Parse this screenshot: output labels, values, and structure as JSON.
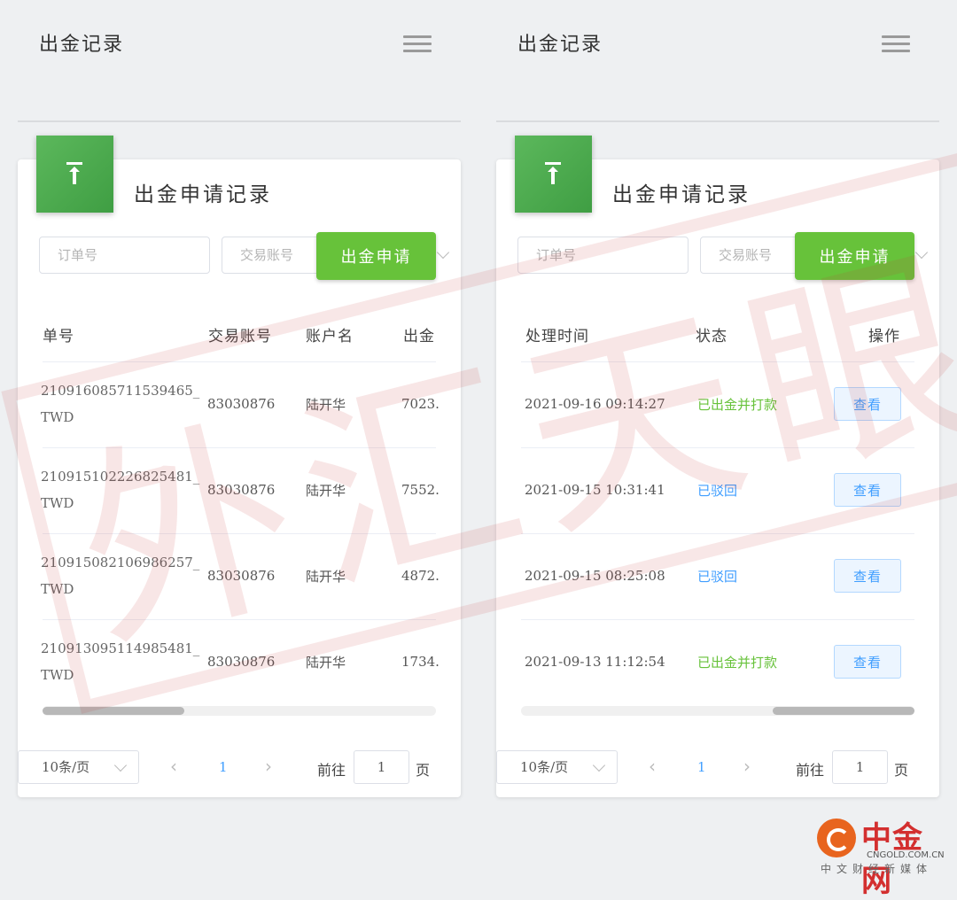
{
  "left": {
    "header": {
      "title": "出金记录"
    },
    "card": {
      "title": "出金申请记录",
      "filters": {
        "order_placeholder": "订单号",
        "account_placeholder": "交易账号",
        "apply_label": "出金申请"
      },
      "columns": [
        "单号",
        "交易账号",
        "账户名",
        "出金"
      ],
      "rows": [
        {
          "order": "210916085711539465_",
          "suffix": "TWD",
          "account": "83030876",
          "name": "陆开华",
          "amount": "7023."
        },
        {
          "order": "210915102226825481_",
          "suffix": "TWD",
          "account": "83030876",
          "name": "陆开华",
          "amount": "7552."
        },
        {
          "order": "210915082106986257_",
          "suffix": "TWD",
          "account": "83030876",
          "name": "陆开华",
          "amount": "4872."
        },
        {
          "order": "210913095114985481_",
          "suffix": "TWD",
          "account": "83030876",
          "name": "陆开华",
          "amount": "1734."
        }
      ],
      "scroll_position": 0.0
    },
    "pagination": {
      "page_size": "10条/页",
      "prev": "‹",
      "current": "1",
      "next": "›",
      "goto_label": "前往",
      "goto_value": "1",
      "goto_unit": "页"
    }
  },
  "right": {
    "header": {
      "title": "出金记录"
    },
    "card": {
      "title": "出金申请记录",
      "filters": {
        "order_placeholder": "订单号",
        "account_placeholder": "交易账号",
        "apply_label": "出金申请"
      },
      "columns": [
        "处理时间",
        "状态",
        "操作"
      ],
      "rows": [
        {
          "time": "2021-09-16 09:14:27",
          "status": "已出金并打款",
          "status_type": "success",
          "action": "查看"
        },
        {
          "time": "2021-09-15 10:31:41",
          "status": "已驳回",
          "status_type": "info",
          "action": "查看"
        },
        {
          "time": "2021-09-15 08:25:08",
          "status": "已驳回",
          "status_type": "info",
          "action": "查看"
        },
        {
          "time": "2021-09-13 11:12:54",
          "status": "已出金并打款",
          "status_type": "success",
          "action": "查看"
        }
      ],
      "scroll_position": 1.0
    },
    "pagination": {
      "page_size": "10条/页",
      "prev": "‹",
      "current": "1",
      "next": "›",
      "goto_label": "前往",
      "goto_value": "1",
      "goto_unit": "页"
    }
  },
  "watermark": "外汇天眼",
  "logo": {
    "name": "中金网",
    "domain": "CNGOLD.COM.CN",
    "tagline": "中文财经新媒体"
  },
  "colors": {
    "accent_green": "#67c23a",
    "link_blue": "#409eff",
    "icon_green": "#4caf50",
    "logo_red": "#d32f2f"
  }
}
